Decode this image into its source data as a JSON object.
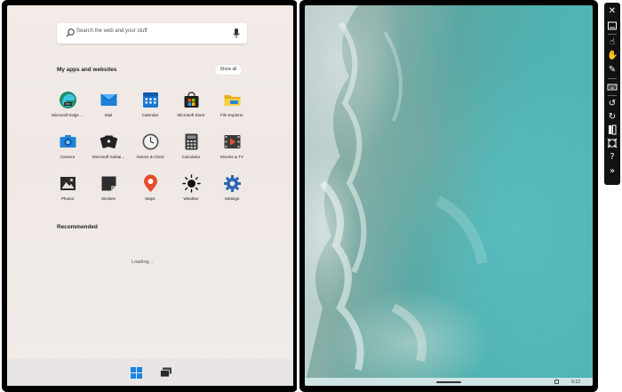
{
  "search": {
    "placeholder": "Search the web and your stuff"
  },
  "apps_section": {
    "title": "My apps and websites",
    "show_all": "Show all"
  },
  "apps": [
    {
      "label": "Microsoft Edge ...",
      "icon": "edge-dev-icon"
    },
    {
      "label": "Mail",
      "icon": "mail-icon"
    },
    {
      "label": "Calendar",
      "icon": "calendar-icon"
    },
    {
      "label": "Microsoft Store",
      "icon": "store-icon"
    },
    {
      "label": "File Explorer",
      "icon": "folder-icon"
    },
    {
      "label": "Camera",
      "icon": "camera-icon"
    },
    {
      "label": "Microsoft Solitai...",
      "icon": "cards-icon"
    },
    {
      "label": "Alarms & Clock",
      "icon": "clock-icon"
    },
    {
      "label": "Calculator",
      "icon": "calculator-icon"
    },
    {
      "label": "Movies & TV",
      "icon": "movies-icon"
    },
    {
      "label": "Photos",
      "icon": "photos-icon"
    },
    {
      "label": "Stickies",
      "icon": "stickies-icon"
    },
    {
      "label": "Maps",
      "icon": "map-pin-icon"
    },
    {
      "label": "Weather",
      "icon": "sun-icon"
    },
    {
      "label": "Settings",
      "icon": "gear-icon"
    }
  ],
  "recommended": {
    "title": "Recommended",
    "loading": "Loading..."
  },
  "right_screen": {
    "time": "6:12"
  },
  "colors": {
    "start_bg": "#efe8e4",
    "accent": "#0078d4",
    "wallpaper": "#4fb3b3"
  }
}
